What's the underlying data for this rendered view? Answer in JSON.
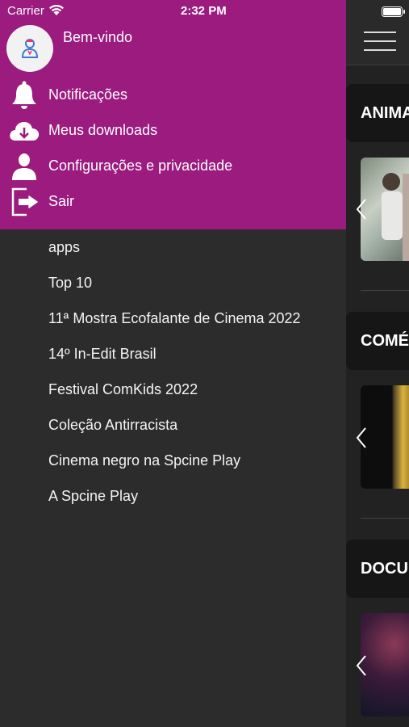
{
  "status_bar": {
    "carrier": "Carrier",
    "time": "2:32 PM"
  },
  "drawer": {
    "welcome": "Bem-vindo",
    "menu": [
      {
        "label": "Notificações",
        "icon": "bell-icon"
      },
      {
        "label": "Meus downloads",
        "icon": "cloud-download-icon"
      },
      {
        "label": "Configurações e privacidade",
        "icon": "user-icon"
      },
      {
        "label": "Sair",
        "icon": "logout-icon"
      }
    ],
    "categories": [
      "apps",
      "Top 10",
      "11ª Mostra Ecofalante de Cinema 2022",
      "14º In-Edit Brasil",
      "Festival ComKids 2022",
      "Coleção Antirracista",
      "Cinema negro na Spcine Play",
      "A Spcine Play"
    ]
  },
  "main": {
    "sections": [
      {
        "title": "ANIMAÇÃO"
      },
      {
        "title": "COMÉDIA"
      },
      {
        "title": "DOCUMENTÁRIO"
      }
    ]
  },
  "colors": {
    "drawer_header": "#9b1b7f",
    "drawer_body": "#2c2c2c",
    "main_bg": "#222222"
  }
}
